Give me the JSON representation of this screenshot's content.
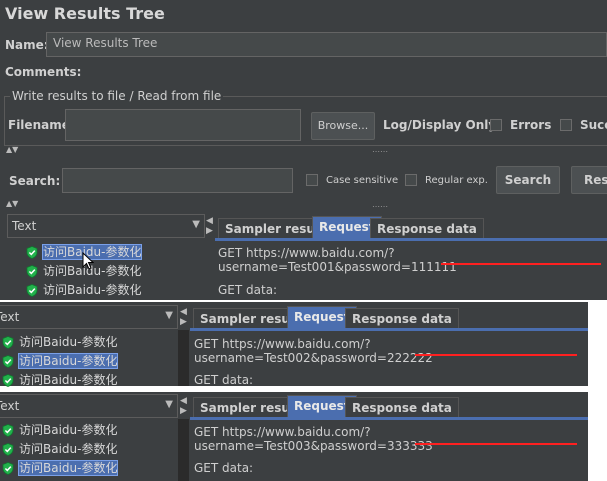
{
  "title": "View Results Tree",
  "name_label": "Name:",
  "name_value": "View Results Tree",
  "comments_label": "Comments:",
  "write_group_label": "Write results to file / Read from file",
  "filename_label": "Filename",
  "browse_label": "Browse...",
  "log_display_label": "Log/Display Only:",
  "errors_label": "Errors",
  "successes_label": "Succ",
  "search_label": "Search:",
  "case_sensitive_label": "Case sensitive",
  "regular_exp_label": "Regular exp.",
  "search_button": "Search",
  "reset_button": "Res",
  "tree_header": "Text",
  "tabs": [
    "Sampler result",
    "Request",
    "Response data"
  ],
  "get_data_label": "GET data:",
  "panel1": {
    "items": [
      "访问Baidu-参数化",
      "访问Baidu-参数化",
      "访问Baidu-参数化"
    ],
    "selected": 0,
    "url": "GET https://www.baidu.com/?username=Test001&password=111111"
  },
  "panel2": {
    "items": [
      "访问Baidu-参数化",
      "访问Baidu-参数化",
      "访问Baidu-参数化"
    ],
    "selected": 1,
    "url": "GET https://www.baidu.com/?username=Test002&password=222222"
  },
  "panel3": {
    "items": [
      "访问Baidu-参数化",
      "访问Baidu-参数化",
      "访问Baidu-参数化"
    ],
    "selected": 2,
    "url": "GET https://www.baidu.com/?username=Test003&password=333333"
  },
  "colors": {
    "accent": "#4b6eaf",
    "success": "#22b14c",
    "underline": "#ff2020"
  }
}
